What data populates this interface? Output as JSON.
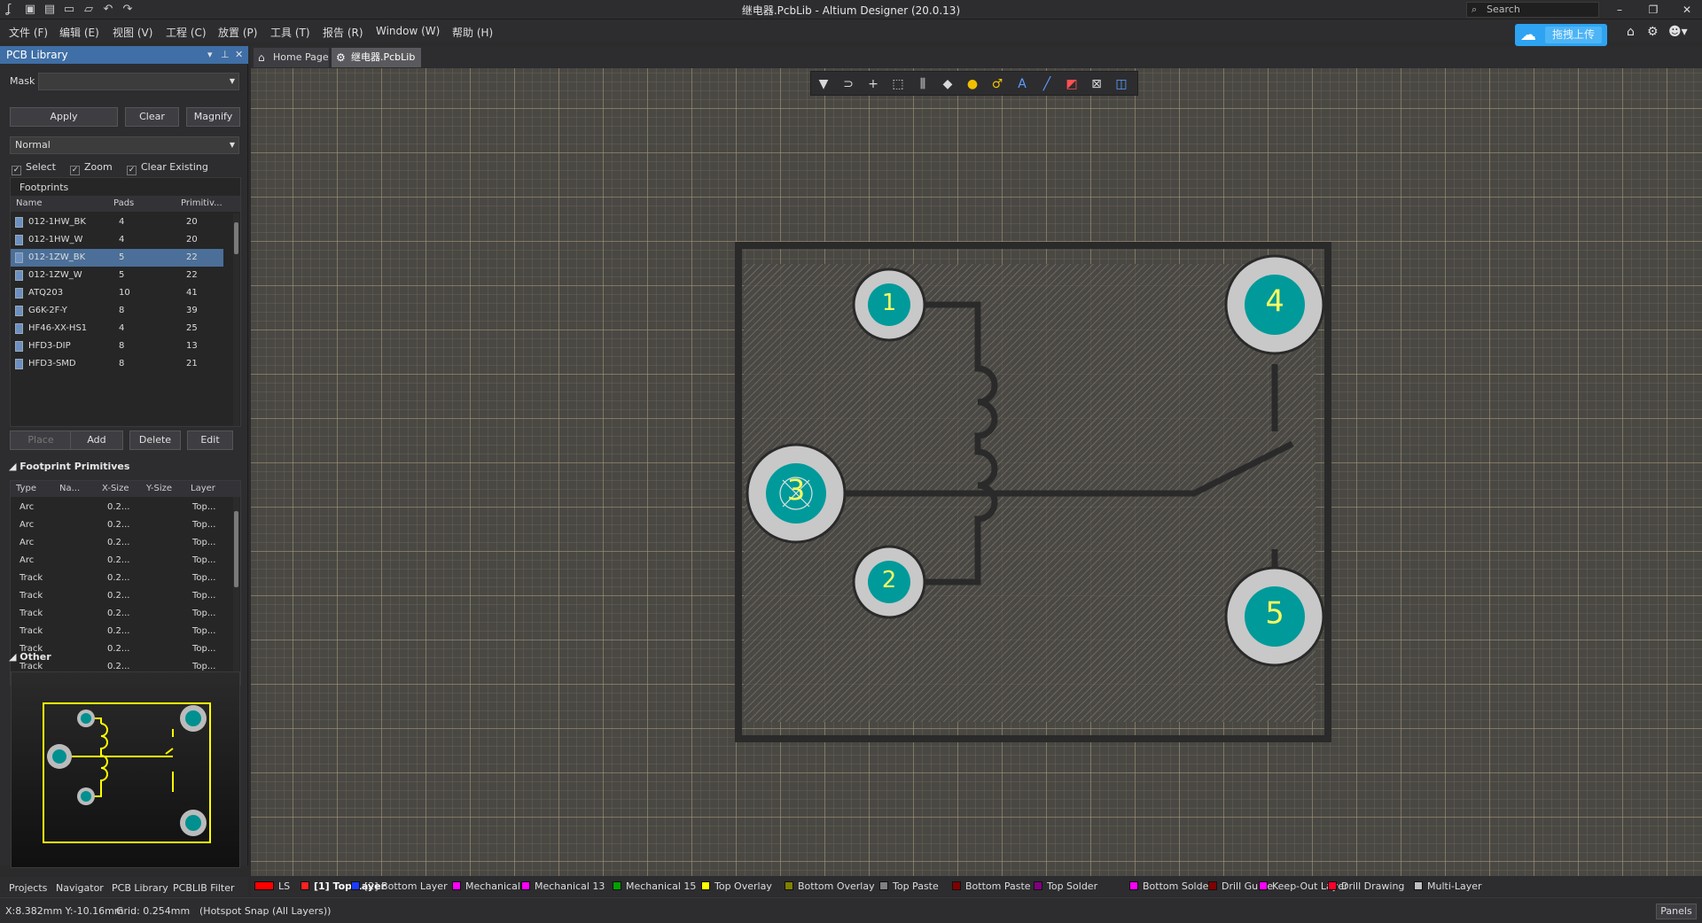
{
  "window": {
    "title": "继电器.PcbLib - Altium Designer (20.0.13)",
    "search_placeholder": "Search",
    "min": "–",
    "restore": "❐",
    "close": "✕"
  },
  "menu": [
    "文件 (F)",
    "编辑 (E)",
    "视图 (V)",
    "工程 (C)",
    "放置 (P)",
    "工具 (T)",
    "报告 (R)",
    "Window (W)",
    "帮助 (H)"
  ],
  "upload": {
    "label": "拖拽上传",
    "icon": "☁"
  },
  "panel": {
    "title": "PCB Library",
    "mask_label": "Mask",
    "mask_value": "",
    "apply": "Apply",
    "clear": "Clear",
    "magnify": "Magnify",
    "mode": "Normal",
    "checks": [
      {
        "label": "Select",
        "checked": true
      },
      {
        "label": "Zoom",
        "checked": true
      },
      {
        "label": "Clear Existing",
        "checked": true
      }
    ],
    "footprints_title": "Footprints",
    "fp_headers": [
      "Name",
      "Pads",
      "Primitiv..."
    ],
    "footprints": [
      {
        "name": "012-1HW_BK",
        "pads": "4",
        "prims": "20"
      },
      {
        "name": "012-1HW_W",
        "pads": "4",
        "prims": "20"
      },
      {
        "name": "012-1ZW_BK",
        "pads": "5",
        "prims": "22",
        "selected": true
      },
      {
        "name": "012-1ZW_W",
        "pads": "5",
        "prims": "22"
      },
      {
        "name": "ATQ203",
        "pads": "10",
        "prims": "41"
      },
      {
        "name": "G6K-2F-Y",
        "pads": "8",
        "prims": "39"
      },
      {
        "name": "HF46-XX-HS1",
        "pads": "4",
        "prims": "25"
      },
      {
        "name": "HFD3-DIP",
        "pads": "8",
        "prims": "13"
      },
      {
        "name": "HFD3-SMD",
        "pads": "8",
        "prims": "21"
      }
    ],
    "place": "Place",
    "add": "Add",
    "delete": "Delete",
    "edit": "Edit",
    "primitives_title": "Footprint Primitives",
    "prim_headers": [
      "Type",
      "Na...",
      "X-Size",
      "Y-Size",
      "Layer"
    ],
    "primitives": [
      {
        "type": "Arc",
        "x": "0.2...",
        "layer": "Top..."
      },
      {
        "type": "Arc",
        "x": "0.2...",
        "layer": "Top..."
      },
      {
        "type": "Arc",
        "x": "0.2...",
        "layer": "Top..."
      },
      {
        "type": "Arc",
        "x": "0.2...",
        "layer": "Top..."
      },
      {
        "type": "Track",
        "x": "0.2...",
        "layer": "Top..."
      },
      {
        "type": "Track",
        "x": "0.2...",
        "layer": "Top..."
      },
      {
        "type": "Track",
        "x": "0.2...",
        "layer": "Top..."
      },
      {
        "type": "Track",
        "x": "0.2...",
        "layer": "Top..."
      },
      {
        "type": "Track",
        "x": "0.2...",
        "layer": "Top..."
      },
      {
        "type": "Track",
        "x": "0.2...",
        "layer": "Top..."
      }
    ],
    "other_title": "Other"
  },
  "bottom_tabs": [
    "Projects",
    "Navigator",
    "PCB Library",
    "PCBLIB Filter"
  ],
  "doc_tabs": [
    {
      "label": "Home Page",
      "icon": "⌂"
    },
    {
      "label": "继电器.PcbLib",
      "icon": "⚙",
      "active": true
    }
  ],
  "pads": [
    "1",
    "2",
    "3",
    "4",
    "5"
  ],
  "layers": [
    {
      "label": "LS",
      "color": "#ff0000"
    },
    {
      "label": "[1] Top Layer",
      "color": "#ff2020",
      "active": true
    },
    {
      "label": "[2] Bottom Layer",
      "color": "#1a3cff"
    },
    {
      "label": "Mechanical 1",
      "color": "#ff00ff"
    },
    {
      "label": "Mechanical 13",
      "color": "#ff00ff"
    },
    {
      "label": "Mechanical 15",
      "color": "#00a000"
    },
    {
      "label": "Top Overlay",
      "color": "#ffff00"
    },
    {
      "label": "Bottom Overlay",
      "color": "#808000"
    },
    {
      "label": "Top Paste",
      "color": "#808080"
    },
    {
      "label": "Bottom Paste",
      "color": "#800000"
    },
    {
      "label": "Top Solder",
      "color": "#800080"
    },
    {
      "label": "Bottom Solder",
      "color": "#ff00ff"
    },
    {
      "label": "Drill Guide",
      "color": "#800000"
    },
    {
      "label": "Keep-Out Layer",
      "color": "#ff00ff"
    },
    {
      "label": "Drill Drawing",
      "color": "#ff002a"
    },
    {
      "label": "Multi-Layer",
      "color": "#c0c0c0"
    }
  ],
  "status": {
    "coords": "X:8.382mm Y:-10.16mm",
    "grid": "Grid: 0.254mm",
    "snap": "(Hotspot Snap (All Layers))",
    "panels": "Panels"
  }
}
